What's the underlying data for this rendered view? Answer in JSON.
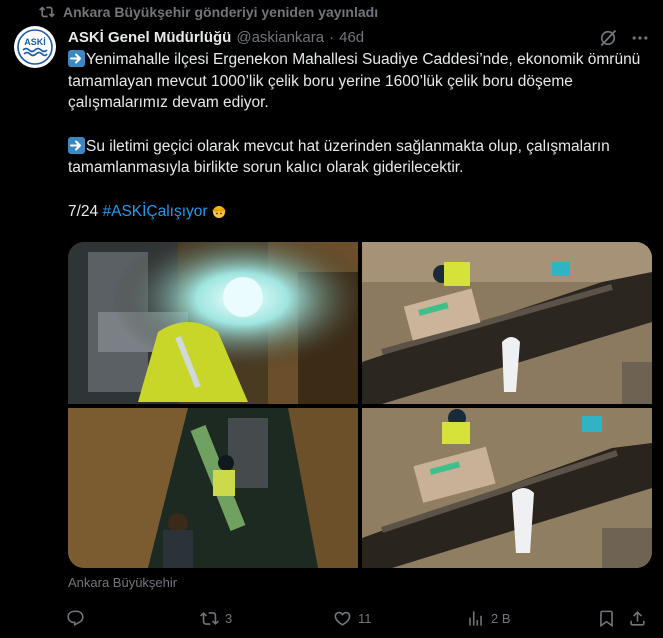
{
  "repost": {
    "text": "Ankara Büyükşehir gönderiyi yeniden yayınladı",
    "icon": "retweet-icon"
  },
  "author": {
    "avatar_text": "ASKİ",
    "name": "ASKİ Genel Müdürlüğü",
    "handle": "@askiankara",
    "separator": "·",
    "time": "46d"
  },
  "tweet": {
    "line1": "Yenimahalle ilçesi Ergenekon Mahallesi Suadiye Caddesi’nde, ekonomik ömrünü tamamlayan mevcut 1000’lik çelik boru yerine 1600’lük çelik boru döşeme çalışmalarımız devam ediyor.",
    "line2": "Su iletimi geçici olarak mevcut hat üzerinden sağlanmakta olup, çalışmaların tamamlanmasıyla birlikte sorun kalıcı olarak giderilecektir.",
    "counter": "7/24",
    "hashtag": "#ASKİÇalışıyor"
  },
  "media": {
    "photos": [
      "photo-welding-worker",
      "photo-pipe-excavation",
      "photo-trench-workers",
      "photo-pipe-repair"
    ]
  },
  "source_label": "Ankara Büyükşehir",
  "actions": {
    "reply_count": "",
    "retweet_count": "3",
    "like_count": "11",
    "views_count": "2 B"
  },
  "colors": {
    "background": "#000000",
    "text": "#e7e9ea",
    "muted": "#71767b",
    "link": "#1d9bf0"
  }
}
